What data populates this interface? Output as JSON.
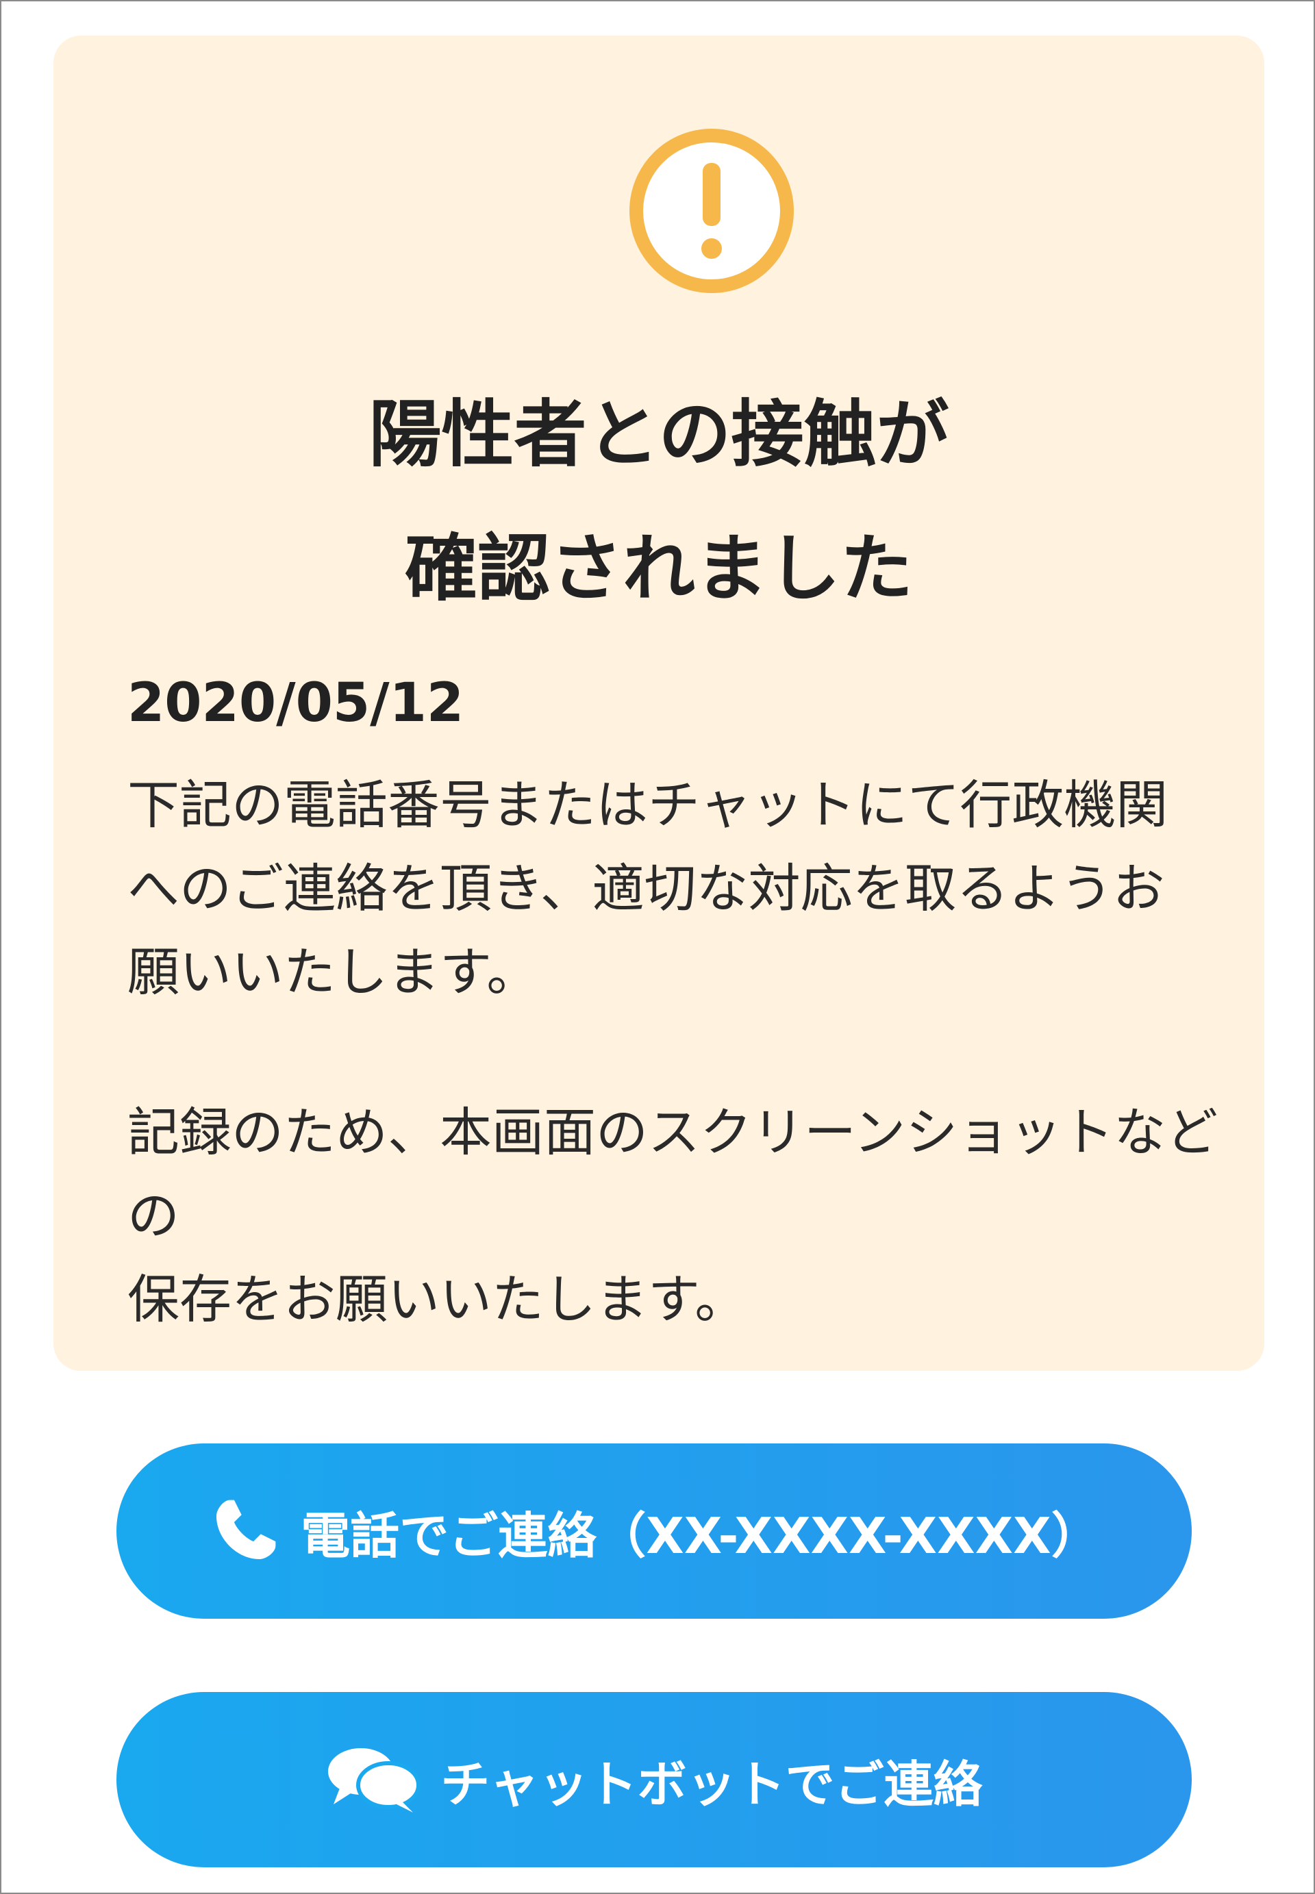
{
  "alert": {
    "icon": "exclamation-circle-icon",
    "icon_color": "#f7b84b",
    "background_color": "#fff2df",
    "title": "陽性者との接触が\n確認されました",
    "date": "2020/05/12",
    "message": "下記の電話番号またはチャットにて行政機関\nへのご連絡を頂き、適切な対応を取るようお\n願いいたします。",
    "save_note": "記録のため、本画面のスクリーンショットなどの\n保存をお願いいたします。"
  },
  "actions": {
    "accent_color": "#1aa8ef",
    "phone_button": {
      "icon": "phone-icon",
      "label": "電話でご連絡（XX-XXXX-XXXX）"
    },
    "chat_button": {
      "icon": "chat-bubbles-icon",
      "label": "チャットボットでご連絡"
    }
  }
}
